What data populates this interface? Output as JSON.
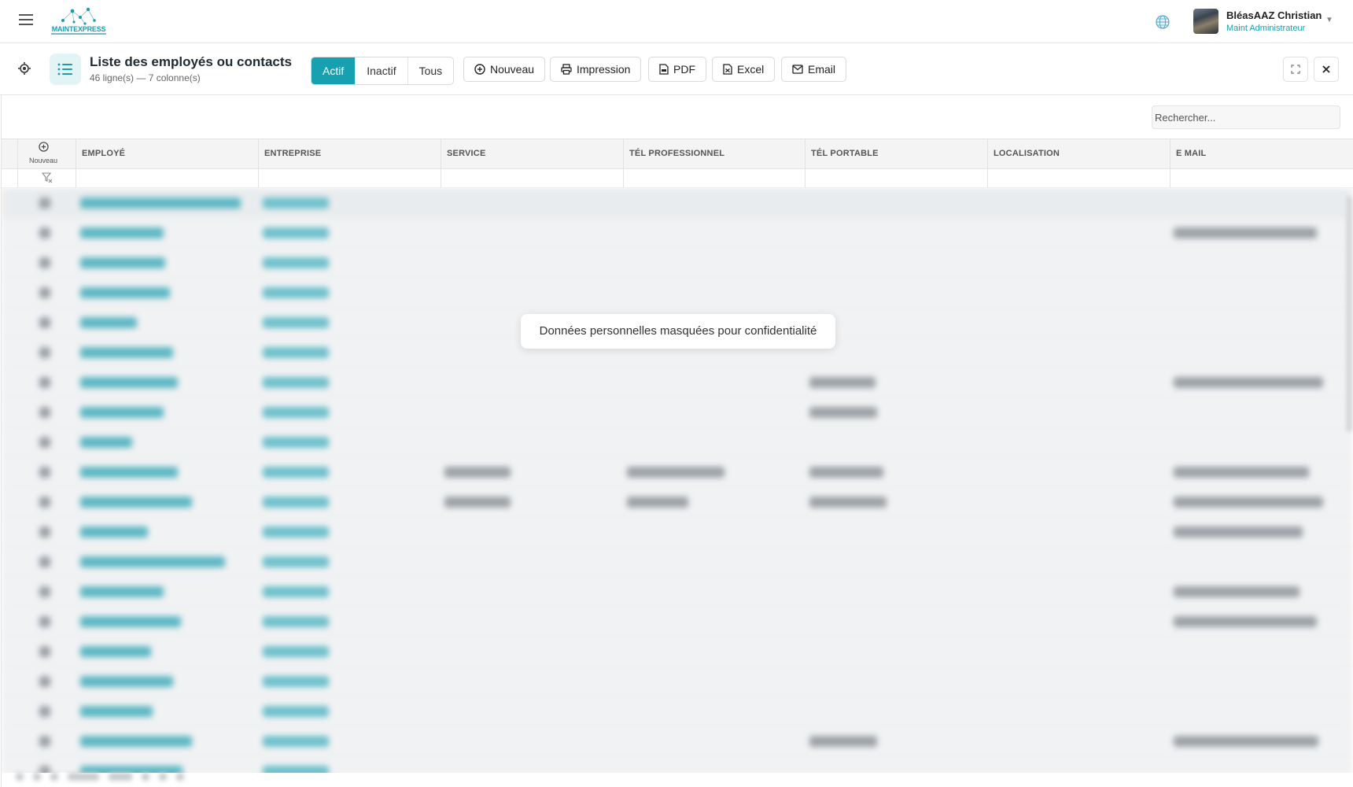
{
  "header": {
    "app_name": "MAINTEXPRESS",
    "user_name": "BléasAAZ Christian",
    "user_role": "Maint Administrateur"
  },
  "toolbar": {
    "title": "Liste des employés ou contacts",
    "subtitle": "46 ligne(s) — 7 colonne(s)",
    "filters": [
      "Actif",
      "Inactif",
      "Tous"
    ],
    "active_filter": "Actif",
    "new_label": "Nouveau",
    "print_label": "Impression",
    "pdf_label": "PDF",
    "excel_label": "Excel",
    "email_label": "Email"
  },
  "grid": {
    "search_placeholder": "Rechercher...",
    "new_column_label": "Nouveau",
    "columns": [
      "EMPLOYÉ",
      "ENTREPRISE",
      "SERVICE",
      "TÉL PROFESSIONNEL",
      "TÉL PORTABLE",
      "LOCALISATION",
      "E MAIL"
    ],
    "privacy_notice": "Données personnelles masquées pour confidentialité"
  },
  "colors": {
    "accent": "#16a0b0",
    "accent_light": "#e3f4f6"
  }
}
